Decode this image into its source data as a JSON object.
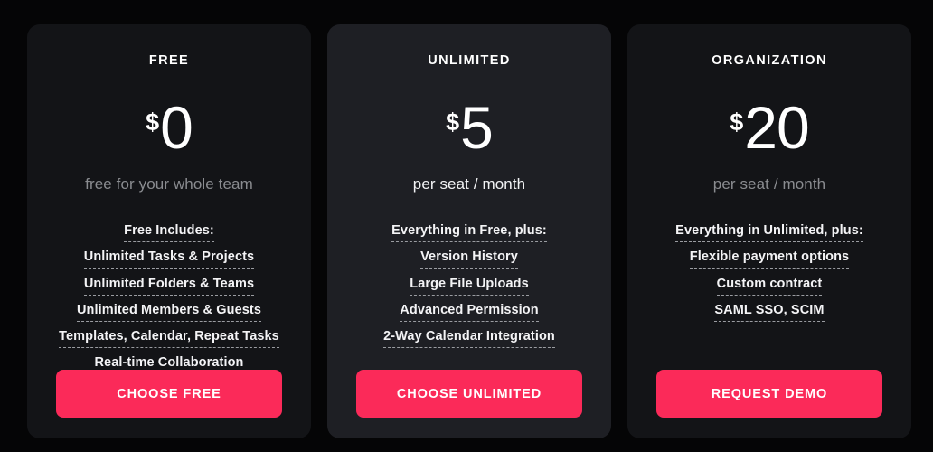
{
  "theme": {
    "page_background": "#050506",
    "card_background": "#131417",
    "featured_card_background": "#1e1f24",
    "accent": "#fb2a59",
    "text_primary": "#ffffff",
    "text_muted": "#8a8c90"
  },
  "plans": [
    {
      "name": "FREE",
      "currency": "$",
      "amount": "0",
      "price_note": "free for your whole team",
      "featured": false,
      "features": [
        "Free Includes:",
        "Unlimited Tasks & Projects",
        "Unlimited Folders & Teams",
        "Unlimited Members & Guests",
        "Templates, Calendar, Repeat Tasks",
        "Real-time Collaboration"
      ],
      "cta": "CHOOSE FREE"
    },
    {
      "name": "UNLIMITED",
      "currency": "$",
      "amount": "5",
      "price_note": "per seat / month",
      "featured": true,
      "features": [
        "Everything in Free, plus:",
        "Version History",
        "Large File Uploads",
        "Advanced Permission",
        "2-Way Calendar Integration"
      ],
      "cta": "CHOOSE UNLIMITED"
    },
    {
      "name": "ORGANIZATION",
      "currency": "$",
      "amount": "20",
      "price_note": "per seat / month",
      "featured": false,
      "features": [
        "Everything in Unlimited, plus:",
        "Flexible payment options",
        "Custom contract",
        "SAML SSO, SCIM"
      ],
      "cta": "REQUEST DEMO"
    }
  ]
}
